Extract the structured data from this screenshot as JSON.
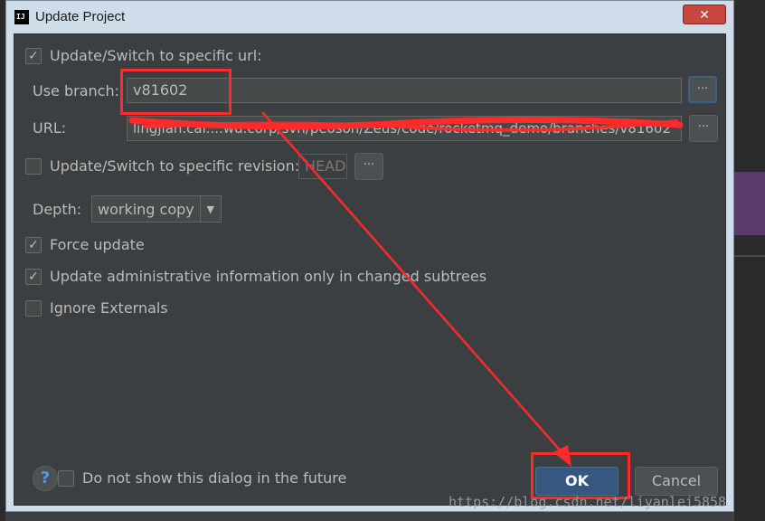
{
  "window": {
    "title": "Update Project",
    "close_glyph": "✕",
    "app_icon_text": "IJ"
  },
  "update_url": {
    "checked": true,
    "label": "Update/Switch to specific url:"
  },
  "branch": {
    "label": "Use branch:",
    "value": "v81602",
    "browse": "···"
  },
  "url": {
    "label": "URL:",
    "value": "lingjian.cai....wd.corp/svn/peoson/Zeus/code/rocketmq_demo/branches/v81602",
    "browse": "···"
  },
  "revision": {
    "checked": false,
    "label": "Update/Switch to specific revision:",
    "value": "HEAD",
    "browse": "···"
  },
  "depth": {
    "label": "Depth:",
    "value": "working copy",
    "arrow": "▼"
  },
  "force_update": {
    "checked": true,
    "label": "Force update"
  },
  "admin_info": {
    "checked": true,
    "label": "Update administrative information only in changed subtrees"
  },
  "ignore_externals": {
    "checked": false,
    "label": "Ignore Externals"
  },
  "footer": {
    "help": "?",
    "dont_show": {
      "checked": false,
      "label": "Do not show this dialog in the future"
    },
    "ok": "OK",
    "cancel": "Cancel"
  },
  "watermark": "https://blog.csdn.net/liyanlei5858",
  "colors": {
    "annotation": "#ff2a2a",
    "ok_button": "#365880",
    "content_bg": "#3c3f41",
    "title_bar": "#cfdcea"
  }
}
